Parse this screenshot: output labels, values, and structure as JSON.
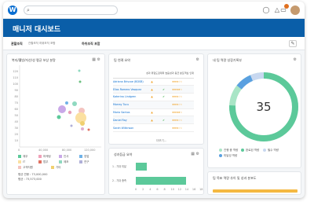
{
  "header": {
    "logo_letter": "W",
    "search_placeholder": "",
    "notification_count": "3"
  },
  "page_title": "매니저 대시보드",
  "subnav": {
    "item1": "관할조직",
    "item2": "관할조직 하위조직 포함",
    "item3": "하위조직 포함"
  },
  "bubble_chart": {
    "title": "복지/웰빙/자산/성 평균 보상 분량",
    "y_ticks": [
      "120",
      "110",
      "100",
      "90",
      "80",
      "70",
      "60",
      "50",
      "40",
      "30",
      "20",
      "10"
    ],
    "x_ticks": [
      "0",
      "40,000",
      "80,000",
      "120,000"
    ],
    "legend": [
      "재무",
      "마케팅",
      "인사",
      "영업",
      "IT",
      "법무",
      "제조",
      "연구",
      "고객지원",
      "기타"
    ],
    "footer1": "평균 연봉 : 73,000,000",
    "footer2": "평균 : 73,573,000"
  },
  "table_card": {
    "title": "팀 연례 요약",
    "headers": [
      "",
      "성과 위험도",
      "잠재력 높음",
      "성과 등급 분포",
      "핵심 인재"
    ],
    "rows": [
      {
        "name": "Adriana Briscoe (BDSB)",
        "risk": "warn",
        "potential": "",
        "rating": "★★★☆☆",
        "key": ""
      },
      {
        "name": "Elias Romero Vasquez",
        "risk": "warn",
        "potential": "check",
        "rating": "★★★★☆",
        "key": ""
      },
      {
        "name": "Katerina Lindgren",
        "risk": "warn",
        "potential": "check",
        "rating": "★★★☆☆",
        "key": ""
      },
      {
        "name": "Morray Tucu",
        "risk": "",
        "potential": "",
        "rating": "★★★☆☆",
        "key": ""
      },
      {
        "name": "Maria Santos",
        "risk": "warn",
        "potential": "",
        "rating": "★★★★☆",
        "key": ""
      },
      {
        "name": "Daniel Ray",
        "risk": "warn",
        "potential": "check",
        "rating": "★★★☆☆",
        "key": ""
      },
      {
        "name": "Sarah Wilkinson",
        "risk": "",
        "potential": "",
        "rating": "★★★☆☆",
        "key": ""
      }
    ],
    "more": "더보기..."
  },
  "donut_card": {
    "title": "내 팀 역량 성장기록부",
    "center_value": "35",
    "legend": [
      "진행 중 역량",
      "완료된 역량",
      "필수 역량",
      "미달성 역량"
    ]
  },
  "bar_card": {
    "title": "성과등급 요약",
    "rows": [
      {
        "label": "1 - 기대 미달",
        "value": 3
      },
      {
        "label": "2 - 기대 충족",
        "value": 14
      }
    ],
    "x_ticks": [
      "0",
      "2",
      "4",
      "6",
      "8",
      "10",
      "12",
      "14",
      "16",
      "18"
    ]
  },
  "bottom_card": {
    "title": "팀 목표 역량 추이 및 성과 분포도"
  },
  "colors": {
    "accent": "#0a5ea8",
    "teal": "#5cc99a",
    "donut_main": "#5cc99a",
    "donut_light": "#a9e5c6",
    "donut_blue": "#5aa0e0"
  }
}
